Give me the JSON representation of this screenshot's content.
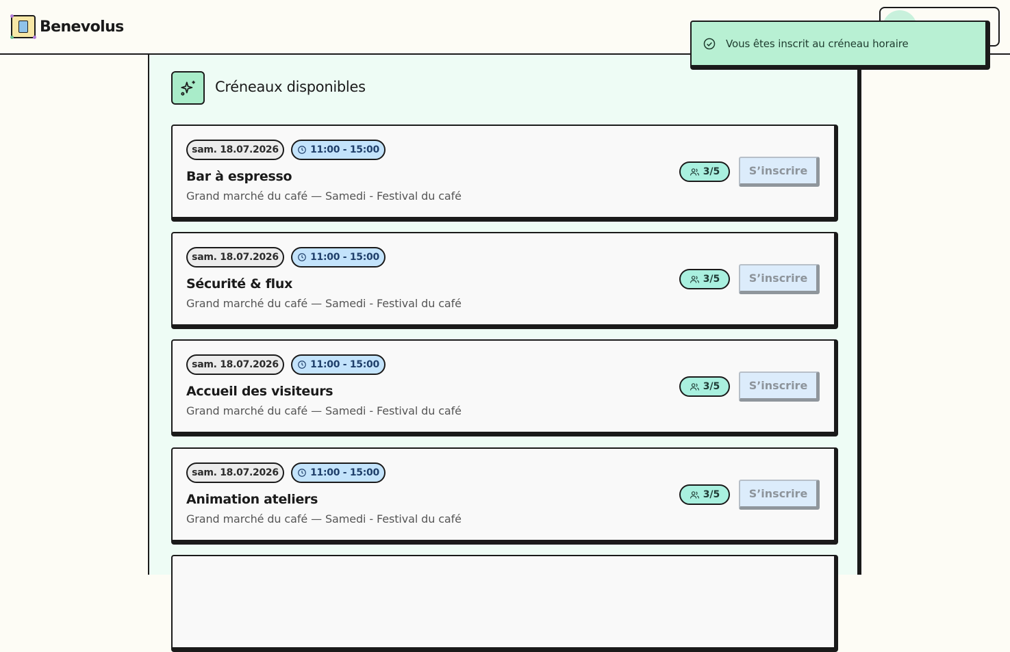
{
  "brand": {
    "name": "Benevolus"
  },
  "toast": {
    "message": "Vous êtes inscrit au créneau horaire"
  },
  "panel": {
    "title": "Créneaux disponibles"
  },
  "slots": [
    {
      "date": "sam. 18.07.2026",
      "time": "11:00 - 15:00",
      "title": "Bar à espresso",
      "subtitle": "Grand marché du café — Samedi - Festival du café",
      "count": "3/5",
      "button": "S’inscrire"
    },
    {
      "date": "sam. 18.07.2026",
      "time": "11:00 - 15:00",
      "title": "Sécurité & flux",
      "subtitle": "Grand marché du café — Samedi - Festival du café",
      "count": "3/5",
      "button": "S’inscrire"
    },
    {
      "date": "sam. 18.07.2026",
      "time": "11:00 - 15:00",
      "title": "Accueil des visiteurs",
      "subtitle": "Grand marché du café — Samedi - Festival du café",
      "count": "3/5",
      "button": "S’inscrire"
    },
    {
      "date": "sam. 18.07.2026",
      "time": "11:00 - 15:00",
      "title": "Animation ateliers",
      "subtitle": "Grand marché du café — Samedi - Festival du café",
      "count": "3/5",
      "button": "S’inscrire"
    }
  ],
  "colors": {
    "accent_green": "#a9ecc9",
    "toast_bg": "#b8f0d3",
    "time_pill": "#c3e3fb",
    "count_pill": "#a9f0df",
    "panel_bg": "#eefcf5"
  },
  "icons": {
    "panel": "sparkles-icon",
    "toast": "check-circle-icon",
    "time": "clock-icon",
    "count": "users-icon"
  }
}
